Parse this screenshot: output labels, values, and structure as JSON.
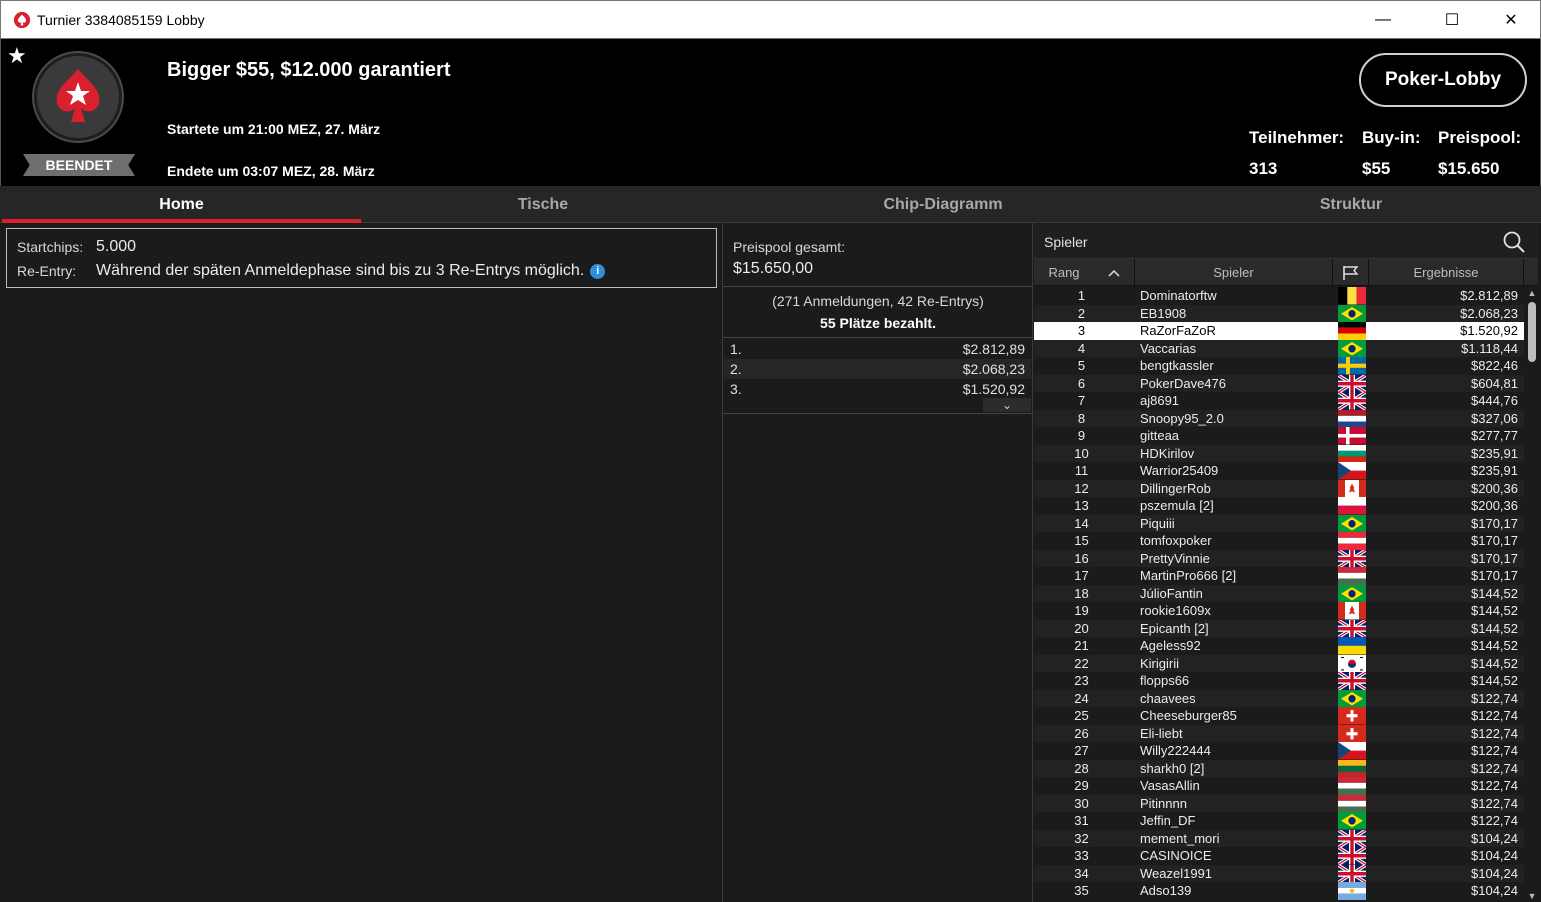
{
  "window": {
    "title": "Turnier 3384085159 Lobby",
    "minimize": "—",
    "maximize": "☐",
    "close": "✕"
  },
  "header": {
    "status_badge": "BEENDET",
    "tournament_name": "Bigger $55, $12.000 garantiert",
    "started": "Startete um 21:00 MEZ, 27. März",
    "ended": "Endete um 03:07 MEZ, 28. März",
    "lobby_button": "Poker-Lobby",
    "stats": {
      "participants_label": "Teilnehmer:",
      "participants_value": "313",
      "buyin_label": "Buy-in:",
      "buyin_value": "$55",
      "prizepool_label": "Preispool:",
      "prizepool_value": "$15.650"
    }
  },
  "tabs": [
    {
      "label": "Home",
      "active": true
    },
    {
      "label": "Tische",
      "active": false
    },
    {
      "label": "Chip-Diagramm",
      "active": false
    },
    {
      "label": "Struktur",
      "active": false
    }
  ],
  "info": {
    "startchips_label": "Startchips:",
    "startchips_value": "5.000",
    "reentry_label": "Re-Entry:",
    "reentry_value": "Während der späten Anmeldephase sind bis zu 3 Re-Entrys möglich.",
    "info_icon": "i"
  },
  "prizepool": {
    "total_label": "Preispool gesamt:",
    "total_value": "$15.650,00",
    "registrations": "(271 Anmeldungen, 42 Re-Entrys)",
    "places_paid": "55 Plätze bezahlt.",
    "payouts": [
      {
        "rank": "1.",
        "amount": "$2.812,89"
      },
      {
        "rank": "2.",
        "amount": "$2.068,23"
      },
      {
        "rank": "3.",
        "amount": "$1.520,92"
      }
    ],
    "expand_icon": "⌄"
  },
  "players": {
    "search_label": "Spieler",
    "columns": {
      "rank": "Rang",
      "player": "Spieler",
      "results": "Ergebnisse"
    },
    "selected_rank": "3",
    "rows": [
      {
        "rank": "1",
        "name": "Dominatorftw",
        "flag": "be",
        "result": "$2.812,89"
      },
      {
        "rank": "2",
        "name": "EB1908",
        "flag": "br",
        "result": "$2.068,23"
      },
      {
        "rank": "3",
        "name": "RaZorFaZoR",
        "flag": "de",
        "result": "$1.520,92"
      },
      {
        "rank": "4",
        "name": "Vaccarias",
        "flag": "br",
        "result": "$1.118,44"
      },
      {
        "rank": "5",
        "name": "bengtkassler",
        "flag": "se",
        "result": "$822,46"
      },
      {
        "rank": "6",
        "name": "PokerDave476",
        "flag": "gb",
        "result": "$604,81"
      },
      {
        "rank": "7",
        "name": "aj8691",
        "flag": "gb",
        "result": "$444,76"
      },
      {
        "rank": "8",
        "name": "Snoopy95_2.0",
        "flag": "nl",
        "result": "$327,06"
      },
      {
        "rank": "9",
        "name": "gitteaa",
        "flag": "dk",
        "result": "$277,77"
      },
      {
        "rank": "10",
        "name": "HDKirilov",
        "flag": "bg",
        "result": "$235,91"
      },
      {
        "rank": "11",
        "name": "Warrior25409",
        "flag": "cz",
        "result": "$235,91"
      },
      {
        "rank": "12",
        "name": "DillingerRob",
        "flag": "ca",
        "result": "$200,36"
      },
      {
        "rank": "13",
        "name": "pszemula [2]",
        "flag": "pl",
        "result": "$200,36"
      },
      {
        "rank": "14",
        "name": "Piquiii",
        "flag": "br",
        "result": "$170,17"
      },
      {
        "rank": "15",
        "name": "tomfoxpoker",
        "flag": "at",
        "result": "$170,17"
      },
      {
        "rank": "16",
        "name": "PrettyVinnie",
        "flag": "gb",
        "result": "$170,17"
      },
      {
        "rank": "17",
        "name": "MartinPro666 [2]",
        "flag": "hu",
        "result": "$170,17"
      },
      {
        "rank": "18",
        "name": "JúlioFantin",
        "flag": "br",
        "result": "$144,52"
      },
      {
        "rank": "19",
        "name": "rookie1609x",
        "flag": "ca",
        "result": "$144,52"
      },
      {
        "rank": "20",
        "name": "Epicanth [2]",
        "flag": "gb",
        "result": "$144,52"
      },
      {
        "rank": "21",
        "name": "Ageless92",
        "flag": "ua",
        "result": "$144,52"
      },
      {
        "rank": "22",
        "name": "Kirigirii",
        "flag": "kr",
        "result": "$144,52"
      },
      {
        "rank": "23",
        "name": "flopps66",
        "flag": "gb",
        "result": "$144,52"
      },
      {
        "rank": "24",
        "name": "chaavees",
        "flag": "br",
        "result": "$122,74"
      },
      {
        "rank": "25",
        "name": "Cheeseburger85",
        "flag": "ch",
        "result": "$122,74"
      },
      {
        "rank": "26",
        "name": "Eli-liebt",
        "flag": "ch",
        "result": "$122,74"
      },
      {
        "rank": "27",
        "name": "Willy222444",
        "flag": "cz",
        "result": "$122,74"
      },
      {
        "rank": "28",
        "name": "sharkh0 [2]",
        "flag": "lt",
        "result": "$122,74"
      },
      {
        "rank": "29",
        "name": "VasasAllin",
        "flag": "hu",
        "result": "$122,74"
      },
      {
        "rank": "30",
        "name": "Pitinnnn",
        "flag": "hu",
        "result": "$122,74"
      },
      {
        "rank": "31",
        "name": "Jeffin_DF",
        "flag": "br",
        "result": "$122,74"
      },
      {
        "rank": "32",
        "name": "mement_mori",
        "flag": "gb",
        "result": "$104,24"
      },
      {
        "rank": "33",
        "name": "CASINOICE",
        "flag": "gb",
        "result": "$104,24"
      },
      {
        "rank": "34",
        "name": "Weazel1991",
        "flag": "gb",
        "result": "$104,24"
      },
      {
        "rank": "35",
        "name": "Adso139",
        "flag": "ar",
        "result": "$104,24"
      }
    ]
  },
  "colors": {
    "accent": "#d8202e",
    "header_bg": "#000000",
    "panel_bg": "#1b1b1b",
    "selected_row": "#ffffff",
    "info_icon": "#2f8fd8"
  }
}
